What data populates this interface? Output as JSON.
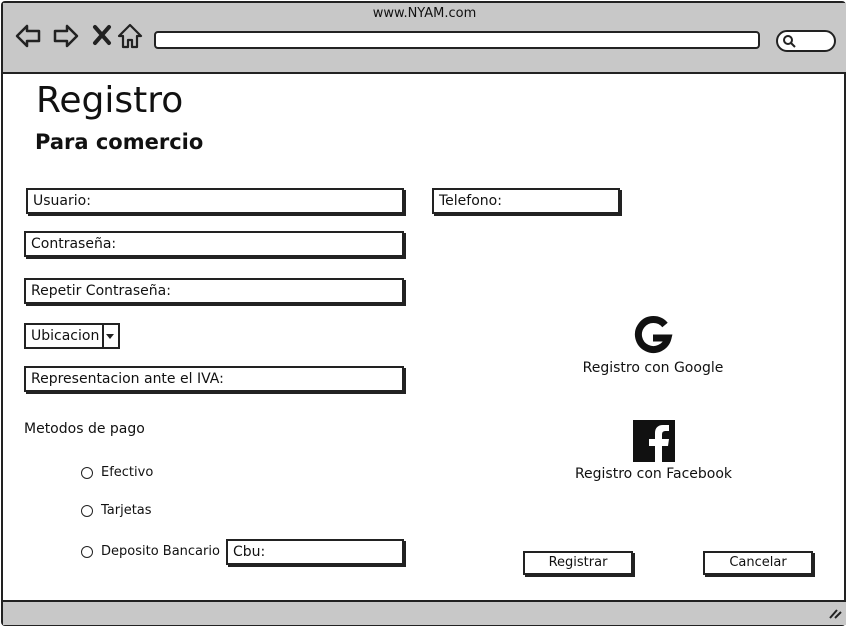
{
  "window": {
    "title": "www.NYAM.com"
  },
  "nav_icons": [
    "back-icon",
    "forward-icon",
    "close-icon",
    "home-icon"
  ],
  "page": {
    "title": "Registro",
    "subtitle": "Para comercio"
  },
  "form": {
    "usuario": "Usuario:",
    "telefono": "Telefono:",
    "contrasena": "Contraseña:",
    "repetir_contrasena": "Repetir Contraseña:",
    "ubicacion": "Ubicacion",
    "iva": "Representacion ante el IVA:",
    "cbu": "Cbu:"
  },
  "payment": {
    "heading": "Metodos de pago",
    "options": [
      "Efectivo",
      "Tarjetas",
      "Deposito Bancario"
    ]
  },
  "social": {
    "google": "Registro con Google",
    "facebook": "Registro con Facebook"
  },
  "buttons": {
    "register": "Registrar",
    "cancel": "Cancelar"
  }
}
